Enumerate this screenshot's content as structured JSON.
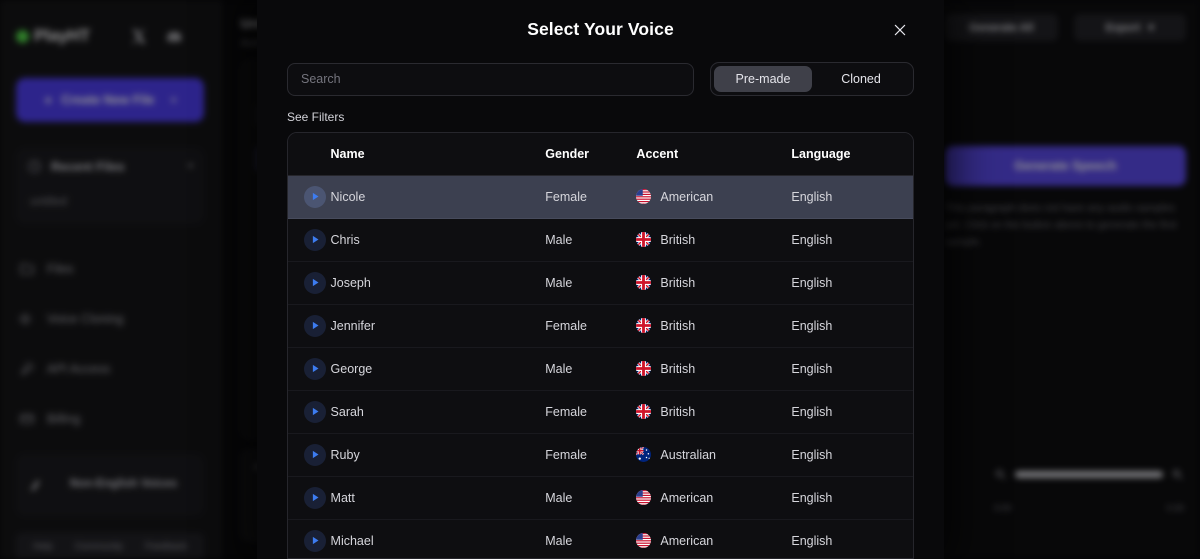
{
  "background": {
    "sidebar": {
      "brand": {
        "name": "PlayHT",
        "dot_color": "#53d84a"
      },
      "header_icons": [
        "x-twitter-icon",
        "discord-icon"
      ],
      "create_button": {
        "label": "Create New File",
        "icon": "plus-icon",
        "caret": "chevron-down-icon",
        "color": "#4f3ff0"
      },
      "recent": {
        "title": "Recent Files",
        "icon": "clock-icon",
        "chevron": "chevron-down-icon",
        "items": [
          "untitled"
        ]
      },
      "nav_items": [
        {
          "label": "Files",
          "icon": "folder-icon"
        },
        {
          "label": "Voice Cloning",
          "icon": "megaphone-icon"
        },
        {
          "label": "API Access",
          "icon": "wrench-icon"
        },
        {
          "label": "Billing",
          "icon": "credit-card-icon"
        }
      ],
      "promo": {
        "label": "Non-English Voices",
        "icon": "globe-icon"
      },
      "footer_links": [
        "Help",
        "Community",
        "Feedback"
      ]
    },
    "editor": {
      "title": "Untitled",
      "subtitle": "Auto-saved",
      "bottom_label": "Audio"
    },
    "right_panel": {
      "generate_all_label": "Generate All",
      "export_label": "Export",
      "export_caret": "chevron-down-icon",
      "generate_speech_label": "Generate Speech",
      "note": "This paragraph does not have any audio samples yet. Click on the button above to generate the first sample.",
      "zoom": {
        "out_icon": "zoom-out-icon",
        "in_icon": "zoom-in-icon",
        "fill_percent": 30,
        "left_label": "0:00",
        "right_label": "0:30"
      }
    }
  },
  "modal": {
    "title": "Select Your Voice",
    "close_icon": "close-icon",
    "search": {
      "placeholder": "Search",
      "value": ""
    },
    "tabs": [
      {
        "label": "Pre-made",
        "active": true
      },
      {
        "label": "Cloned",
        "active": false
      }
    ],
    "filters_link": "See Filters",
    "table": {
      "columns": [
        "",
        "Name",
        "Gender",
        "Accent",
        "Language"
      ],
      "rows": [
        {
          "play_icon": "play-icon",
          "name": "Nicole",
          "gender": "Female",
          "accent": "American",
          "flag": "us",
          "language": "English",
          "selected": true
        },
        {
          "play_icon": "play-icon",
          "name": "Chris",
          "gender": "Male",
          "accent": "British",
          "flag": "gb",
          "language": "English",
          "selected": false
        },
        {
          "play_icon": "play-icon",
          "name": "Joseph",
          "gender": "Male",
          "accent": "British",
          "flag": "gb",
          "language": "English",
          "selected": false
        },
        {
          "play_icon": "play-icon",
          "name": "Jennifer",
          "gender": "Female",
          "accent": "British",
          "flag": "gb",
          "language": "English",
          "selected": false
        },
        {
          "play_icon": "play-icon",
          "name": "George",
          "gender": "Male",
          "accent": "British",
          "flag": "gb",
          "language": "English",
          "selected": false
        },
        {
          "play_icon": "play-icon",
          "name": "Sarah",
          "gender": "Female",
          "accent": "British",
          "flag": "gb",
          "language": "English",
          "selected": false
        },
        {
          "play_icon": "play-icon",
          "name": "Ruby",
          "gender": "Female",
          "accent": "Australian",
          "flag": "au",
          "language": "English",
          "selected": false
        },
        {
          "play_icon": "play-icon",
          "name": "Matt",
          "gender": "Male",
          "accent": "American",
          "flag": "us",
          "language": "English",
          "selected": false
        },
        {
          "play_icon": "play-icon",
          "name": "Michael",
          "gender": "Male",
          "accent": "American",
          "flag": "us",
          "language": "English",
          "selected": false
        }
      ]
    }
  }
}
